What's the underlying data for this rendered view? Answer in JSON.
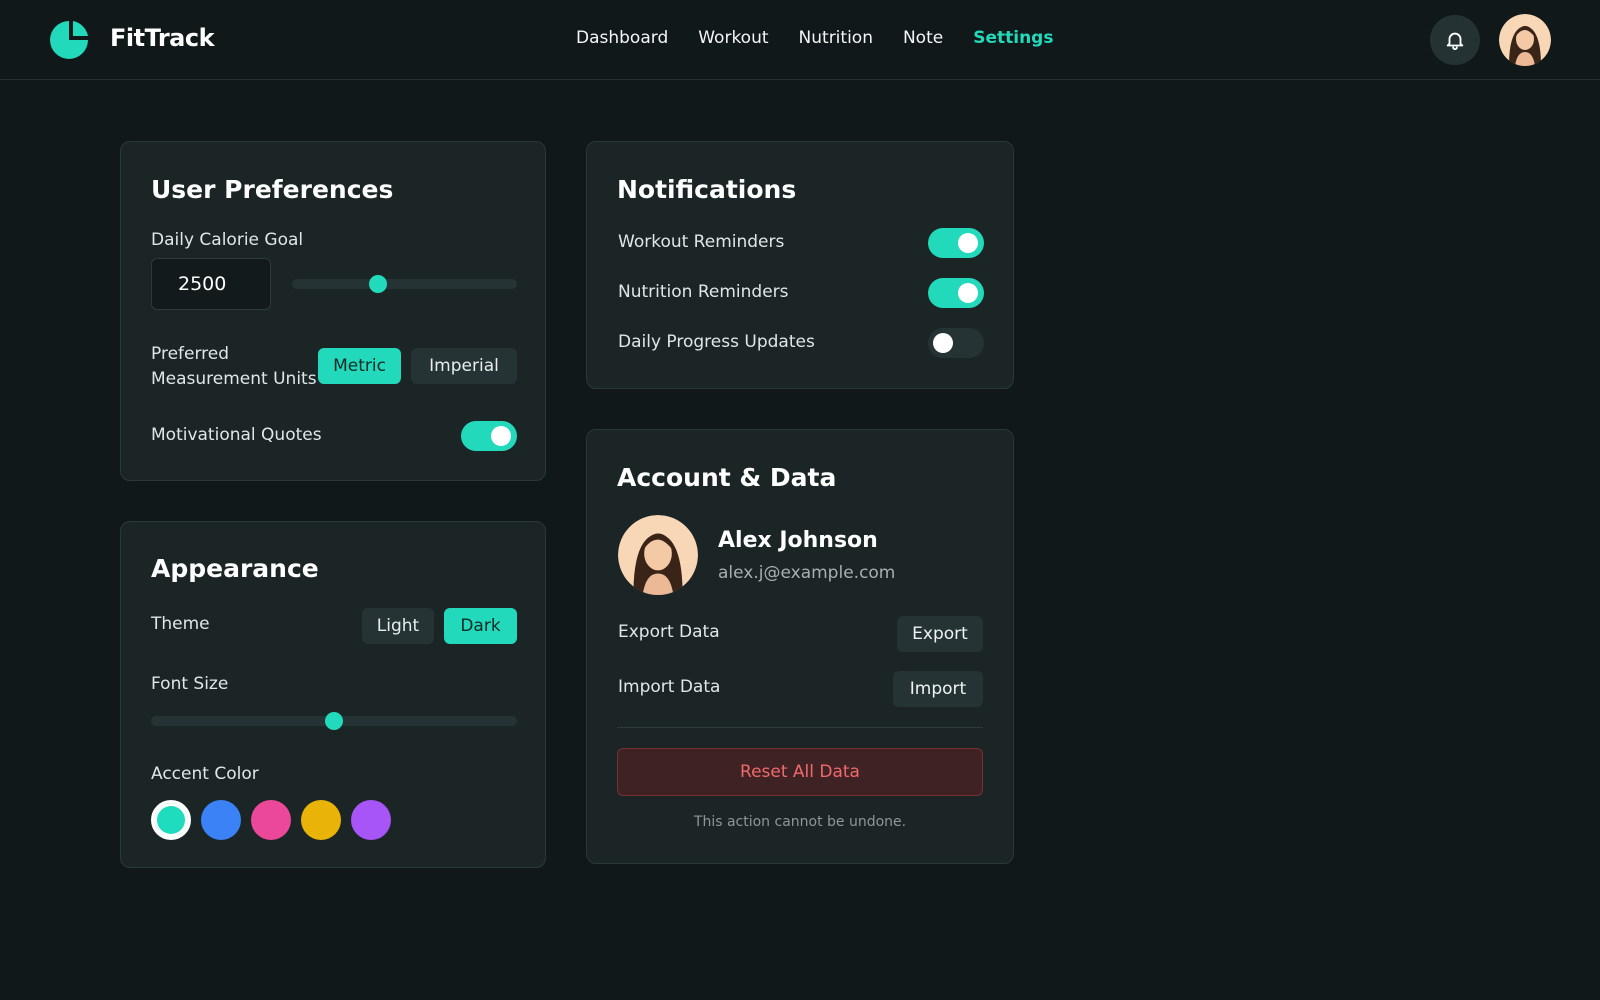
{
  "app": {
    "brand": "FitTrack",
    "accent": "#23d9bb"
  },
  "nav": {
    "items": [
      {
        "label": "Dashboard"
      },
      {
        "label": "Workout"
      },
      {
        "label": "Nutrition"
      },
      {
        "label": "Note"
      },
      {
        "label": "Settings",
        "active": true
      }
    ],
    "icons": [
      "bell-icon",
      "user-avatar"
    ]
  },
  "preferences": {
    "title": "User Preferences",
    "calorie_label": "Daily Calorie Goal",
    "calorie_value": "2500",
    "calorie_slider_fraction": 0.38,
    "units_label_line1": "Preferred",
    "units_label_line2": "Measurement Units",
    "units_options": [
      "Metric",
      "Imperial"
    ],
    "units_selected": "Metric",
    "quotes_label": "Motivational Quotes",
    "quotes_on": true
  },
  "appearance": {
    "title": "Appearance",
    "theme_label": "Theme",
    "theme_options": [
      "Light",
      "Dark"
    ],
    "theme_selected": "Dark",
    "font_label": "Font Size",
    "font_slider_fraction": 0.5,
    "accent_label": "Accent Color",
    "accent_colors": [
      "#1fdcbf",
      "#3b82f6",
      "#ec4899",
      "#eab308",
      "#a855f7"
    ],
    "accent_selected": "#1fdcbf"
  },
  "notifications": {
    "title": "Notifications",
    "items": [
      {
        "label": "Workout Reminders",
        "on": true
      },
      {
        "label": "Nutrition Reminders",
        "on": true
      },
      {
        "label": "Daily Progress Updates",
        "on": false
      }
    ]
  },
  "account": {
    "title": "Account & Data",
    "name": "Alex Johnson",
    "email": "alex.j@example.com",
    "export_label": "Export Data",
    "export_button": "Export",
    "import_label": "Import Data",
    "import_button": "Import",
    "reset_button": "Reset All Data",
    "warning": "This action cannot be undone.",
    "danger_color": "#f0696b"
  }
}
